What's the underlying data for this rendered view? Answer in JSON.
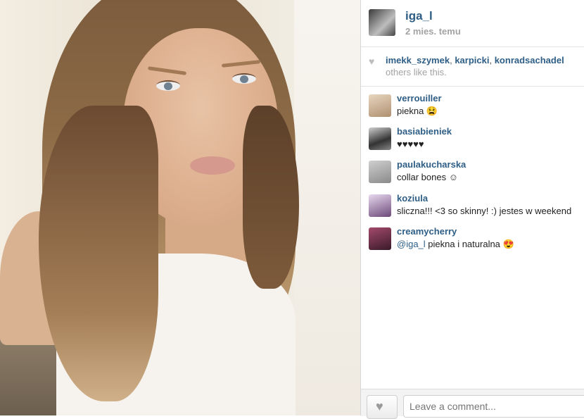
{
  "post": {
    "username": "iga_l",
    "time": "2 mies. temu"
  },
  "likes": {
    "users": [
      "imekk_szymek",
      "karpicki",
      "konradsachadel"
    ],
    "tail": "others like this."
  },
  "comments": [
    {
      "user": "verrouiller",
      "text": "piekna 😫"
    },
    {
      "user": "basiabieniek",
      "text": "♥♥♥♥♥"
    },
    {
      "user": "paulakucharska",
      "text": "collar bones ☺"
    },
    {
      "user": "koziula",
      "text": "sliczna!!! <3 so skinny! :) jestes w weekend"
    },
    {
      "user": "creamycherry",
      "mention": "@iga_l",
      "text": " piekna i naturalna 😍"
    }
  ],
  "composer": {
    "placeholder": "Leave a comment..."
  },
  "icons": {
    "like": "heart-icon",
    "likes_indicator": "heart-icon"
  },
  "colors": {
    "link": "#2e5e86",
    "muted": "#a3a3a3"
  }
}
